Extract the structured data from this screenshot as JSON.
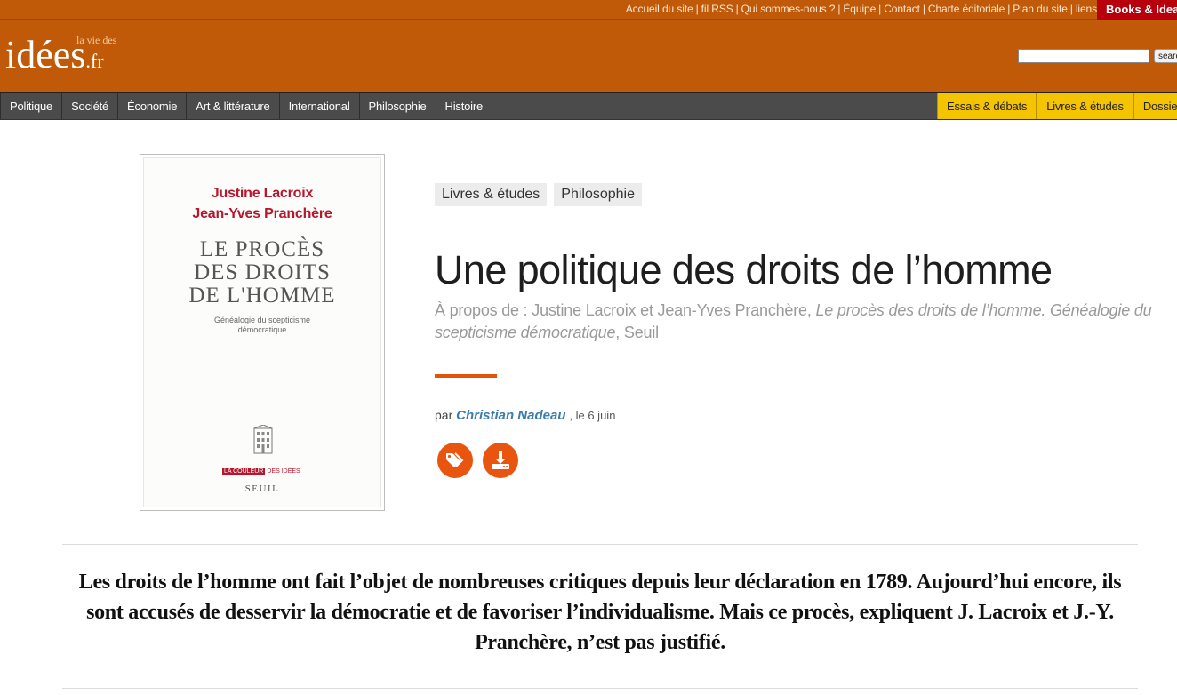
{
  "top_links": {
    "items": [
      "Accueil du site",
      "fil RSS",
      "Qui sommes-nous ?",
      "Équipe",
      "Contact",
      "Charte éditoriale",
      "Plan du site",
      "liens"
    ],
    "separator": "|",
    "books_ideas": "Books & Ideas"
  },
  "logo": {
    "tagline": "la vie des",
    "main": "idées",
    "tld": ".fr"
  },
  "search": {
    "value": "",
    "button_label": "search"
  },
  "nav": {
    "left": [
      "Politique",
      "Société",
      "Économie",
      "Art & littérature",
      "International",
      "Philosophie",
      "Histoire"
    ],
    "right": [
      "Essais & débats",
      "Livres & études",
      "Dossiers"
    ]
  },
  "cover": {
    "authors": [
      "Justine Lacroix",
      "Jean-Yves Pranchère"
    ],
    "title_lines": [
      "LE PROCÈS",
      "DES DROITS",
      "DE L'HOMME"
    ],
    "subtitle_lines": [
      "Généalogie du scepticisme",
      "démocratique"
    ],
    "collection_a": "LA COULEUR",
    "collection_b": "DES IDÉES",
    "publisher": "SEUIL"
  },
  "article": {
    "tags": [
      "Livres & études",
      "Philosophie"
    ],
    "title": "Une politique des droits de l’homme",
    "about_prefix": "À propos de : Justine Lacroix et Jean-Yves Pranchère,",
    "about_book": "Le procès des droits de l’homme. Généalogie du scepticisme démocratique",
    "about_suffix": ", Seuil",
    "by": "par",
    "author": "Christian Nadeau",
    "date": ", le 6 juin",
    "chapo": "Les droits de l’homme ont fait l’objet de nombreuses critiques depuis leur déclaration en 1789. Aujourd’hui encore, ils sont accusés de desservir la démocratie et de favoriser l’individualisme. Mais ce procès, expliquent J. Lacroix et J.-Y. Pranchère, n’est pas justifié."
  },
  "icons": {
    "tag_button": "tags-icon",
    "download_button": "download-icon"
  },
  "colors": {
    "header": "#c05a08",
    "nav": "#4b4b4b",
    "highlight": "#f5c400",
    "accent": "#e9540f",
    "author_link": "#3b7cab",
    "books_ideas": "#b8000c"
  }
}
